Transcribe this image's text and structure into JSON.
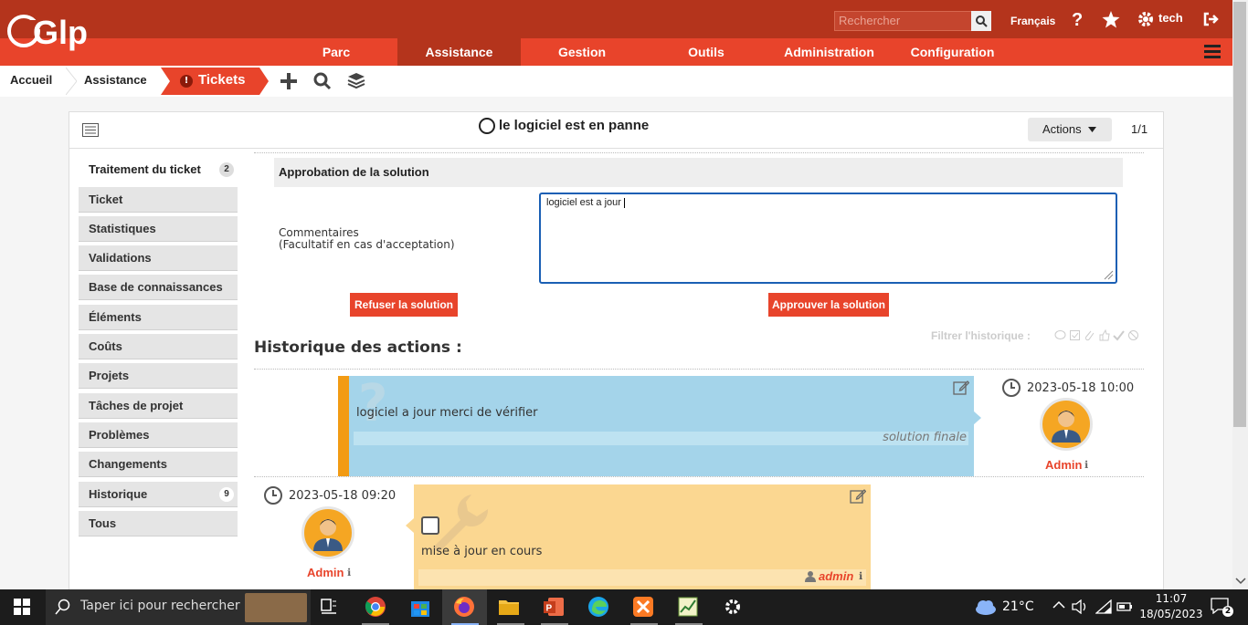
{
  "header": {
    "logo_text": "Glpi",
    "search_placeholder": "Rechercher",
    "language": "Français",
    "user": "tech",
    "colors": {
      "dark": "#b4341c",
      "accent": "#e8442b"
    }
  },
  "nav": [
    "Parc",
    "Assistance",
    "Gestion",
    "Outils",
    "Administration",
    "Configuration"
  ],
  "breadcrumb": [
    "Accueil",
    "Assistance",
    "Tickets"
  ],
  "ticket": {
    "title": "le logiciel est en panne",
    "actions_label": "Actions",
    "pager": "1/1"
  },
  "sidebar": {
    "items": [
      {
        "label": "Traitement du ticket",
        "badge": "2"
      },
      {
        "label": "Ticket"
      },
      {
        "label": "Statistiques"
      },
      {
        "label": "Validations"
      },
      {
        "label": "Base de connaissances"
      },
      {
        "label": "Éléments"
      },
      {
        "label": "Coûts"
      },
      {
        "label": "Projets"
      },
      {
        "label": "Tâches de projet"
      },
      {
        "label": "Problèmes"
      },
      {
        "label": "Changements"
      },
      {
        "label": "Historique",
        "badge": "9"
      },
      {
        "label": "Tous"
      }
    ]
  },
  "approval": {
    "title": "Approbation de la solution",
    "comment_label": "Commentaires",
    "comment_hint": "(Facultatif en cas d'acceptation)",
    "comment_value": "logiciel est a jour ",
    "refuse_label": "Refuser la solution",
    "approve_label": "Approuver la solution"
  },
  "history": {
    "title": "Historique des actions :",
    "filter_label": "Filtrer l'historique :",
    "items": [
      {
        "timestamp": "2023-05-18 10:00",
        "user": "Admin",
        "text": "logiciel a jour merci de vérifier",
        "tag": "solution finale"
      },
      {
        "timestamp": "2023-05-18 09:20",
        "user": "Admin",
        "text": "mise à jour en cours",
        "author": "admin"
      }
    ]
  },
  "taskbar": {
    "search_placeholder": "Taper ici pour rechercher",
    "weather": "21°C",
    "time": "11:07",
    "date": "18/05/2023",
    "notifications": "2"
  }
}
